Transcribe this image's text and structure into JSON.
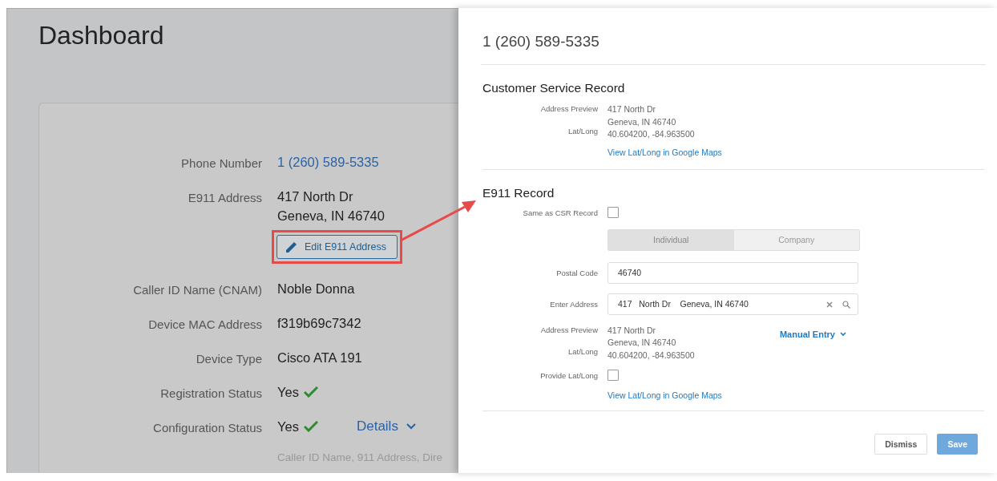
{
  "dashboard": {
    "title": "Dashboard",
    "fields": [
      {
        "kind": "link",
        "label": "Phone Number",
        "value": "1 (260) 589-5335"
      },
      {
        "kind": "address",
        "label": "E911 Address",
        "lines": [
          "417 North Dr",
          "Geneva, IN 46740"
        ],
        "action": {
          "label": "Edit E911 Address",
          "highlighted": true
        }
      },
      {
        "kind": "text",
        "label": "Caller ID Name (CNAM)",
        "value": "Noble Donna"
      },
      {
        "kind": "text",
        "label": "Device MAC Address",
        "value": "f319b69c7342"
      },
      {
        "kind": "text",
        "label": "Device Type",
        "value": "Cisco ATA 191"
      },
      {
        "kind": "status",
        "label": "Registration Status",
        "value": "Yes",
        "ok": true
      },
      {
        "kind": "status",
        "label": "Configuration Status",
        "value": "Yes",
        "ok": true,
        "details": {
          "label": "Details",
          "expanded": false
        }
      },
      {
        "kind": "note",
        "value": "Caller ID Name, 911 Address, Dire"
      }
    ]
  },
  "panel": {
    "title": "1 (260) 589-5335",
    "csr": {
      "heading": "Customer Service Record",
      "preview_label": "Address Preview",
      "preview_lines": [
        "417 North Dr",
        "Geneva, IN 46740"
      ],
      "latlong_label": "Lat/Long",
      "latlong": "40.604200, -84.963500",
      "map_link": "View Lat/Long in Google Maps"
    },
    "e911": {
      "heading": "E911 Record",
      "same_as_csr": {
        "label": "Same as CSR Record",
        "checked": false
      },
      "segments": [
        {
          "label": "Individual",
          "selected": true
        },
        {
          "label": "Company",
          "selected": false
        }
      ],
      "postal_code": {
        "label": "Postal Code",
        "value": "46740"
      },
      "address": {
        "label": "Enter Address",
        "value": "417   North Dr    Geneva, IN 46740"
      },
      "preview_label": "Address Preview",
      "preview_lines": [
        "417 North Dr",
        "Geneva, IN 46740"
      ],
      "latlong_label": "Lat/Long",
      "latlong": "40.604200, -84.963500",
      "manual_entry": {
        "label": "Manual Entry",
        "expanded": false
      },
      "provide_latlong": {
        "label": "Provide Lat/Long",
        "checked": false
      },
      "map_link": "View Lat/Long in Google Maps"
    },
    "buttons": [
      {
        "label": "Dismiss",
        "kind": "secondary"
      },
      {
        "label": "Save",
        "kind": "primary"
      }
    ]
  }
}
